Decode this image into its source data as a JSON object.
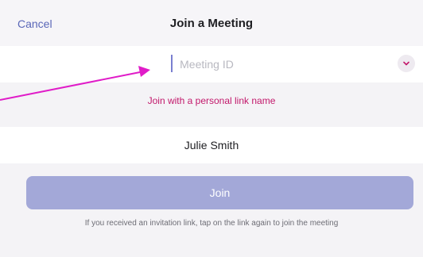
{
  "nav": {
    "cancel_label": "Cancel",
    "title": "Join a Meeting"
  },
  "meeting_id": {
    "placeholder": "Meeting ID",
    "value": ""
  },
  "personal_link_label": "Join with a personal link name",
  "name_field": {
    "value": "Julie Smith"
  },
  "join_button_label": "Join",
  "hint_text": "If you received an invitation link, tap on the link again to join the meeting",
  "icons": {
    "history": "chevron-down-icon",
    "annotation": "annotation-arrow"
  },
  "colors": {
    "accent": "#5a67b8",
    "link": "#c2186b",
    "join_button_disabled": "#a3a8d8",
    "annotation_arrow": "#e01cc8"
  }
}
